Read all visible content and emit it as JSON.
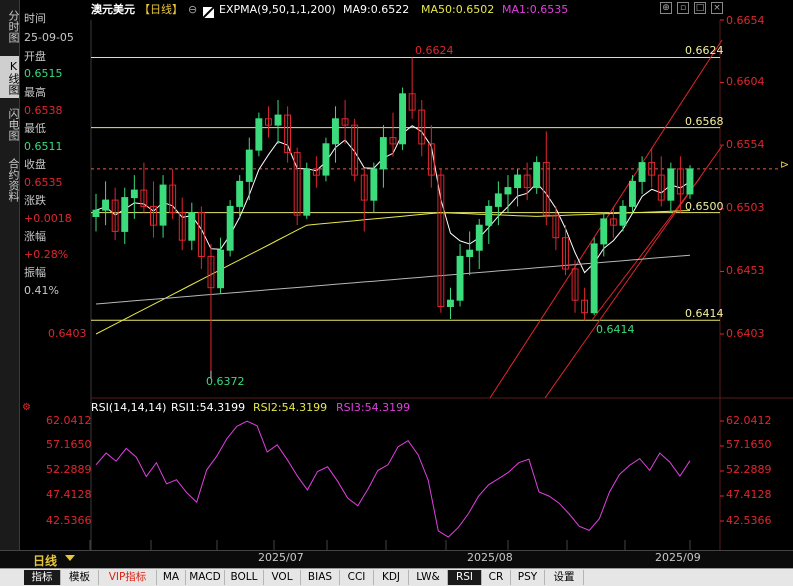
{
  "header": {
    "symbol": "澳元美元",
    "period": "【日线】",
    "indicator": "EXPMA(9,50,1,1,200)",
    "ma9": "MA9:0.6522",
    "ma50": "MA50:0.6502",
    "ma1": "MA1:0.6535"
  },
  "left_tabs": [
    "分时图",
    "K线图",
    "闪电图",
    "合约资料"
  ],
  "info": {
    "time_label": "时间",
    "time_value": "25-09-05",
    "open_label": "开盘",
    "open_value": "0.6515",
    "high_label": "最高",
    "high_value": "0.6538",
    "low_label": "最低",
    "low_value": "0.6511",
    "close_label": "收盘",
    "close_value": "0.6535",
    "chg_label": "涨跌",
    "chg_value": "+0.0018",
    "pct_label": "涨幅",
    "pct_value": "+0.28%",
    "amp_label": "振幅",
    "amp_value": "0.41%"
  },
  "price_axis": [
    "0.6654",
    "0.6604",
    "0.6554",
    "0.6503",
    "0.6453",
    "0.6403"
  ],
  "left_axis_label": "0.6403",
  "annotations": {
    "high_mark": "0.6624",
    "low_mark": "0.6372",
    "valley_mark": "0.6414",
    "level_1": "0.6624",
    "level_2": "0.6568",
    "level_3": "0.6500",
    "level_4": "0.6414"
  },
  "rsi": {
    "title": "RSI(14,14,14)",
    "rsi1": "RSI1:54.3199",
    "rsi2": "RSI2:54.3199",
    "rsi3": "RSI3:54.3199",
    "axis": [
      "62.0412",
      "57.1650",
      "52.2889",
      "47.4128",
      "42.5366"
    ]
  },
  "time_axis": [
    "2025/07",
    "2025/08",
    "2025/09"
  ],
  "period_button": "日线",
  "bottom_tabs": [
    "指标",
    "模板",
    "VIP指标",
    "MA",
    "MACD",
    "BOLL",
    "VOL",
    "BIAS",
    "CCI",
    "KDJ",
    "LW&",
    "RSI",
    "CR",
    "PSY",
    "设置"
  ],
  "active_bottom_tab": "RSI",
  "colors": {
    "up": "#3cdc7c",
    "down": "#e0262e",
    "ma9": "#ffffff",
    "ma50": "#e8e84a",
    "ma1": "#b7b7b7",
    "rsi": "#e040e0",
    "level": "#e8e86a"
  },
  "chart_data": {
    "type": "candlestick",
    "candles": [
      [
        0.6497,
        0.6515,
        0.6485,
        0.6502
      ],
      [
        0.6502,
        0.6525,
        0.649,
        0.651
      ],
      [
        0.651,
        0.652,
        0.6478,
        0.6485
      ],
      [
        0.6485,
        0.652,
        0.6475,
        0.6512
      ],
      [
        0.6512,
        0.653,
        0.6495,
        0.6518
      ],
      [
        0.6518,
        0.654,
        0.65,
        0.6505
      ],
      [
        0.6505,
        0.6525,
        0.648,
        0.649
      ],
      [
        0.649,
        0.653,
        0.648,
        0.6522
      ],
      [
        0.6522,
        0.6535,
        0.6495,
        0.65
      ],
      [
        0.65,
        0.6512,
        0.647,
        0.6478
      ],
      [
        0.6478,
        0.6508,
        0.647,
        0.65
      ],
      [
        0.65,
        0.6505,
        0.6455,
        0.6465
      ],
      [
        0.6465,
        0.6475,
        0.6372,
        0.644
      ],
      [
        0.644,
        0.648,
        0.6435,
        0.647
      ],
      [
        0.647,
        0.651,
        0.6465,
        0.6505
      ],
      [
        0.6505,
        0.653,
        0.6495,
        0.6525
      ],
      [
        0.6525,
        0.656,
        0.651,
        0.655
      ],
      [
        0.655,
        0.658,
        0.6545,
        0.6575
      ],
      [
        0.6575,
        0.6585,
        0.656,
        0.657
      ],
      [
        0.657,
        0.659,
        0.6555,
        0.6578
      ],
      [
        0.6578,
        0.6585,
        0.654,
        0.6548
      ],
      [
        0.6548,
        0.6552,
        0.649,
        0.6498
      ],
      [
        0.6498,
        0.654,
        0.6495,
        0.6535
      ],
      [
        0.6535,
        0.6545,
        0.652,
        0.653
      ],
      [
        0.653,
        0.656,
        0.6525,
        0.6555
      ],
      [
        0.6555,
        0.6585,
        0.654,
        0.6575
      ],
      [
        0.6575,
        0.659,
        0.6555,
        0.657
      ],
      [
        0.657,
        0.6575,
        0.6525,
        0.653
      ],
      [
        0.653,
        0.6535,
        0.6485,
        0.651
      ],
      [
        0.651,
        0.654,
        0.65,
        0.6535
      ],
      [
        0.6535,
        0.657,
        0.652,
        0.656
      ],
      [
        0.656,
        0.658,
        0.6545,
        0.6555
      ],
      [
        0.6555,
        0.66,
        0.655,
        0.6595
      ],
      [
        0.6595,
        0.6624,
        0.6575,
        0.6582
      ],
      [
        0.6582,
        0.659,
        0.6545,
        0.6555
      ],
      [
        0.6555,
        0.657,
        0.652,
        0.653
      ],
      [
        0.653,
        0.6535,
        0.642,
        0.6425
      ],
      [
        0.6425,
        0.644,
        0.6415,
        0.643
      ],
      [
        0.643,
        0.6475,
        0.6425,
        0.6465
      ],
      [
        0.6465,
        0.6485,
        0.645,
        0.647
      ],
      [
        0.647,
        0.6495,
        0.6455,
        0.649
      ],
      [
        0.649,
        0.651,
        0.6475,
        0.6505
      ],
      [
        0.6505,
        0.6525,
        0.649,
        0.6515
      ],
      [
        0.6515,
        0.653,
        0.65,
        0.652
      ],
      [
        0.652,
        0.6535,
        0.6505,
        0.653
      ],
      [
        0.653,
        0.654,
        0.651,
        0.652
      ],
      [
        0.652,
        0.6545,
        0.6515,
        0.654
      ],
      [
        0.654,
        0.6565,
        0.649,
        0.6498
      ],
      [
        0.6498,
        0.6505,
        0.647,
        0.648
      ],
      [
        0.648,
        0.649,
        0.645,
        0.6455
      ],
      [
        0.6455,
        0.6462,
        0.642,
        0.643
      ],
      [
        0.643,
        0.644,
        0.6414,
        0.642
      ],
      [
        0.642,
        0.648,
        0.6418,
        0.6475
      ],
      [
        0.6475,
        0.65,
        0.6465,
        0.6495
      ],
      [
        0.6495,
        0.6505,
        0.648,
        0.649
      ],
      [
        0.649,
        0.651,
        0.6485,
        0.6505
      ],
      [
        0.6505,
        0.653,
        0.65,
        0.6525
      ],
      [
        0.6525,
        0.6545,
        0.6515,
        0.654
      ],
      [
        0.654,
        0.6552,
        0.652,
        0.653
      ],
      [
        0.653,
        0.6545,
        0.6505,
        0.651
      ],
      [
        0.651,
        0.654,
        0.65,
        0.6535
      ],
      [
        0.6535,
        0.6545,
        0.65,
        0.6515
      ],
      [
        0.6515,
        0.6538,
        0.6511,
        0.6535
      ]
    ],
    "rsi": [
      53.5,
      55.8,
      54.2,
      56.7,
      55.0,
      51.2,
      53.9,
      49.8,
      50.6,
      48.1,
      46.2,
      52.5,
      55.2,
      58.6,
      61.0,
      62.0,
      61.1,
      56.0,
      57.4,
      54.5,
      51.3,
      48.6,
      52.2,
      53.1,
      50.3,
      47.0,
      45.5,
      48.7,
      52.4,
      53.5,
      57.0,
      58.2,
      55.4,
      50.5,
      40.6,
      39.4,
      41.3,
      44.0,
      47.4,
      49.6,
      50.8,
      52.1,
      53.9,
      54.6,
      48.2,
      47.4,
      46.0,
      43.9,
      41.5,
      40.7,
      43.0,
      48.2,
      51.6,
      53.4,
      54.7,
      52.4,
      55.8,
      54.0,
      51.3,
      54.3
    ]
  }
}
